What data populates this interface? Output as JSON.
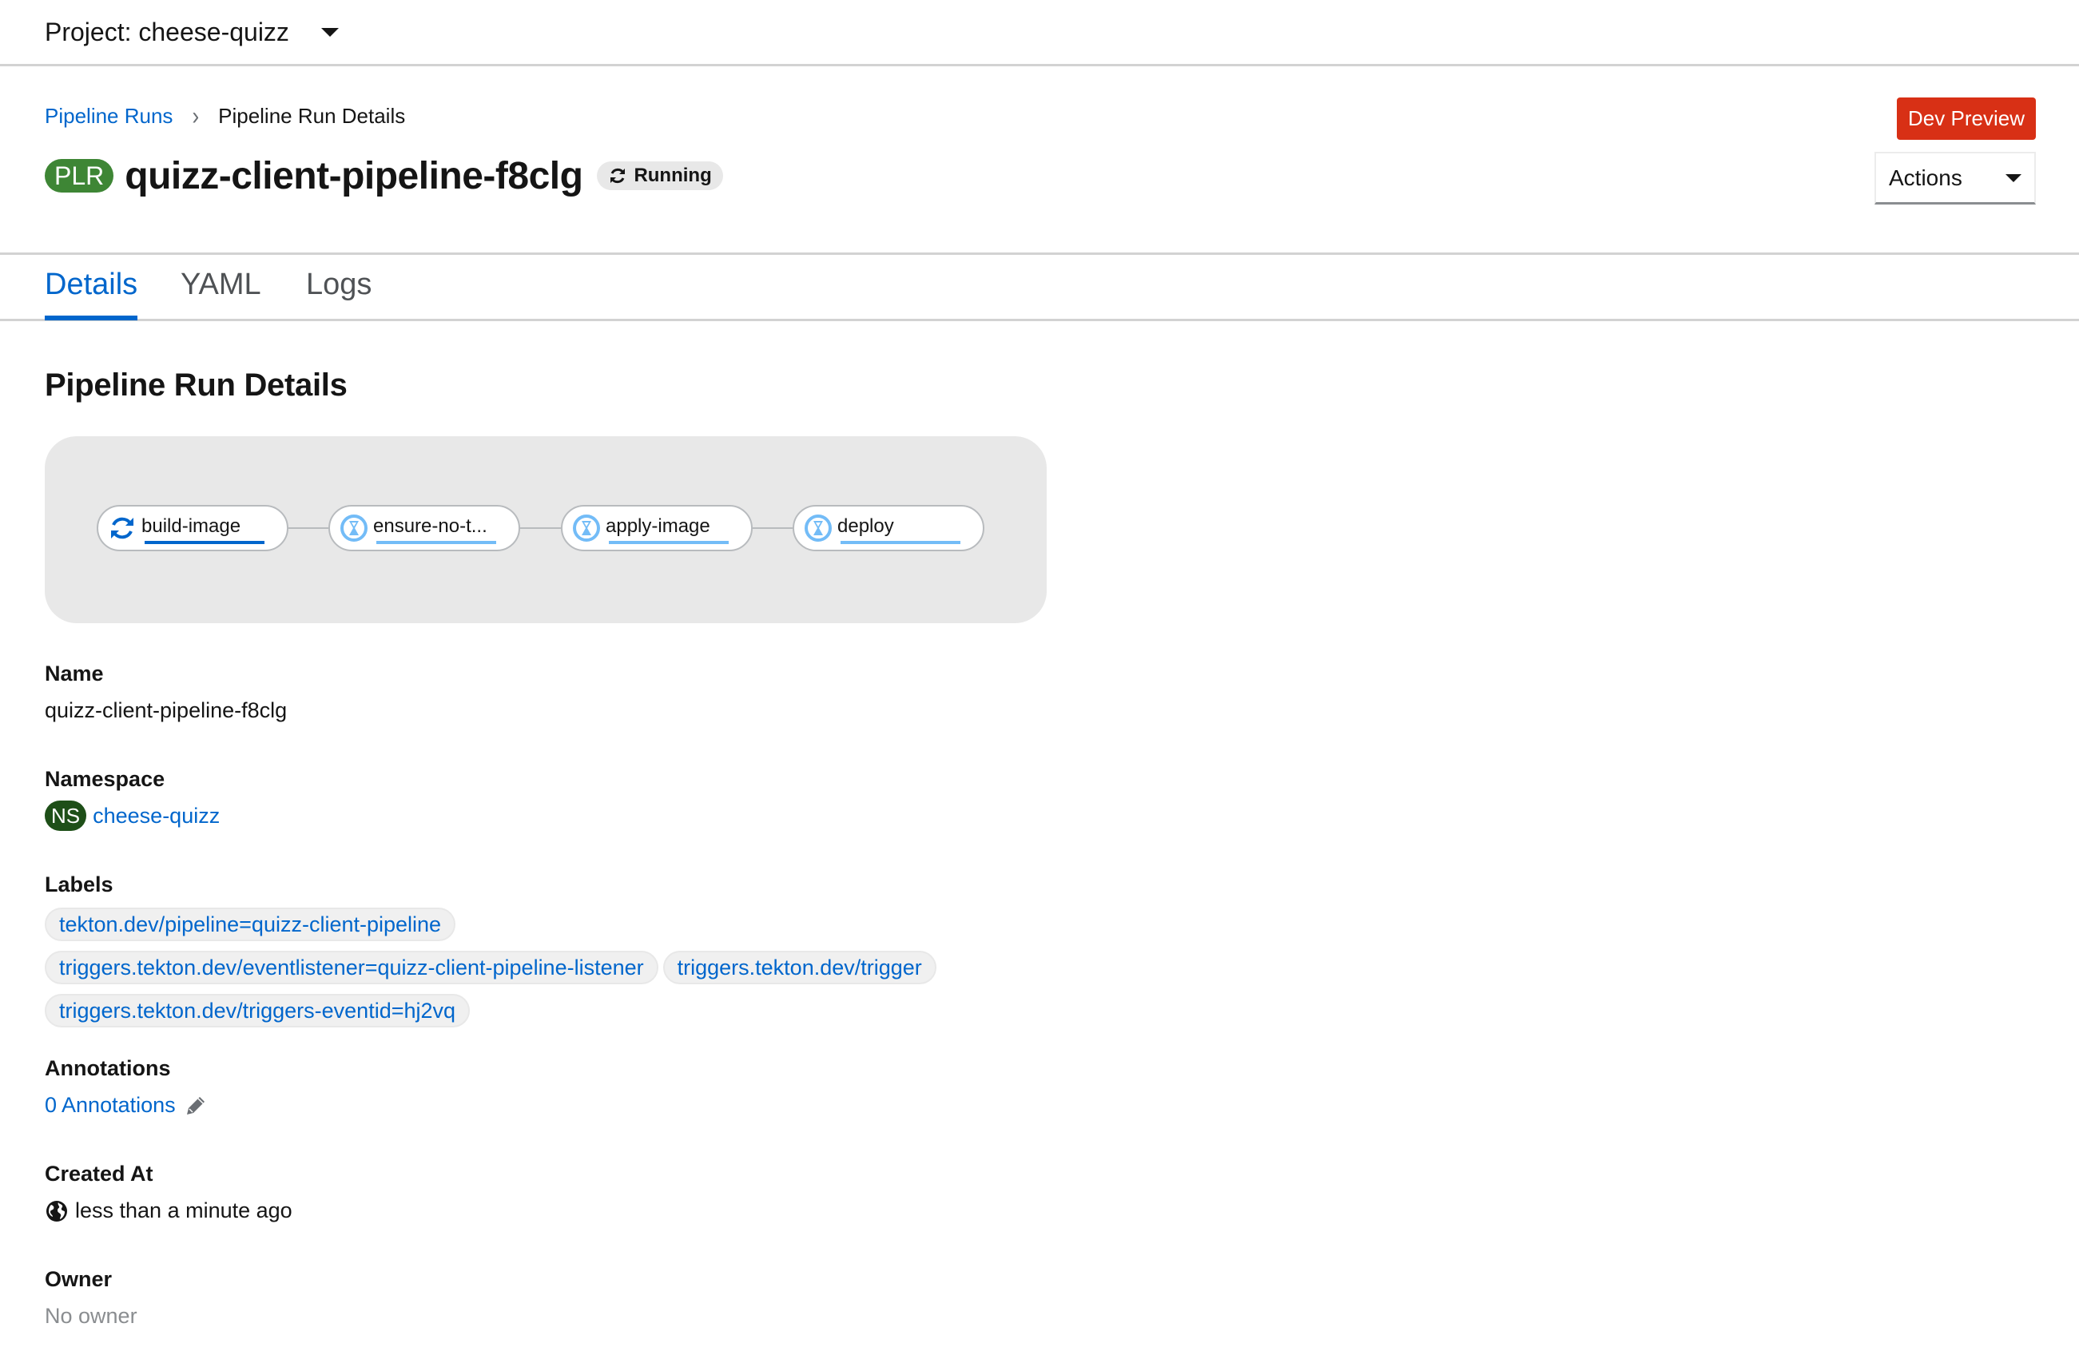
{
  "project": {
    "label": "Project: cheese-quizz"
  },
  "breadcrumb": {
    "parent": "Pipeline Runs",
    "current": "Pipeline Run Details"
  },
  "header": {
    "badge": "PLR",
    "title": "quizz-client-pipeline-f8clg",
    "status": "Running",
    "dev_preview": "Dev Preview",
    "actions": "Actions"
  },
  "tabs": [
    {
      "label": "Details",
      "active": true
    },
    {
      "label": "YAML",
      "active": false
    },
    {
      "label": "Logs",
      "active": false
    }
  ],
  "section_title": "Pipeline Run Details",
  "pipeline": {
    "tasks": [
      {
        "name": "build-image",
        "status": "running",
        "icon": "sync-icon"
      },
      {
        "name": "ensure-no-t...",
        "status": "pending",
        "icon": "hourglass-icon"
      },
      {
        "name": "apply-image",
        "status": "pending",
        "icon": "hourglass-icon"
      },
      {
        "name": "deploy",
        "status": "pending",
        "icon": "hourglass-icon"
      }
    ],
    "colors": {
      "running": "#0066cc",
      "pending": "#73bcf7"
    }
  },
  "details": {
    "name": {
      "label": "Name",
      "value": "quizz-client-pipeline-f8clg"
    },
    "namespace": {
      "label": "Namespace",
      "badge": "NS",
      "value": "cheese-quizz"
    },
    "labels": {
      "label": "Labels",
      "items": [
        "tekton.dev/pipeline=quizz-client-pipeline",
        "triggers.tekton.dev/eventlistener=quizz-client-pipeline-listener",
        "triggers.tekton.dev/trigger",
        "triggers.tekton.dev/triggers-eventid=hj2vq"
      ]
    },
    "annotations": {
      "label": "Annotations",
      "value": "0 Annotations"
    },
    "created_at": {
      "label": "Created At",
      "value": "less than a minute ago"
    },
    "owner": {
      "label": "Owner",
      "value": "No owner"
    }
  },
  "colors": {
    "link": "#0066cc",
    "plr_badge": "#3e8635",
    "ns_badge": "#1e4f18",
    "dev_preview": "#d83015"
  }
}
